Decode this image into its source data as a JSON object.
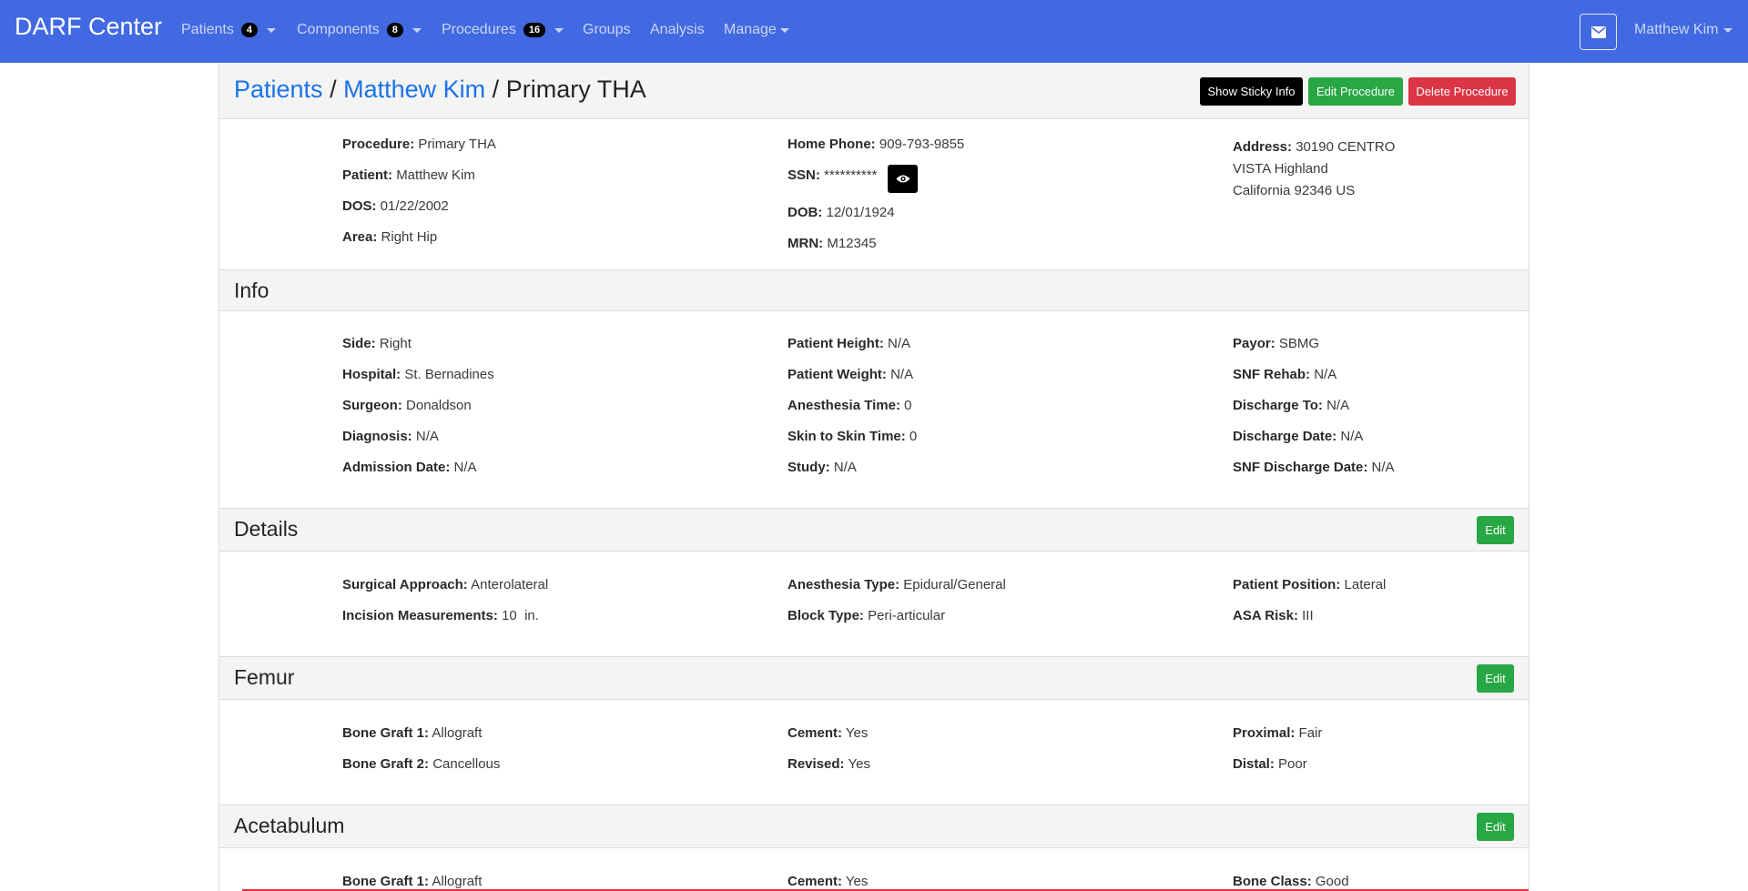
{
  "nav": {
    "brand": "DARF Center",
    "items": [
      {
        "label": "Patients",
        "badge": "4"
      },
      {
        "label": "Components",
        "badge": "8"
      },
      {
        "label": "Procedures",
        "badge": "16"
      },
      {
        "label": "Groups"
      },
      {
        "label": "Analysis"
      },
      {
        "label": "Manage"
      }
    ],
    "user": "Matthew Kim"
  },
  "breadcrumb": {
    "patients": "Patients",
    "patient": "Matthew Kim",
    "current": "Primary THA",
    "sep": "/"
  },
  "actions": {
    "sticky": "Show Sticky Info",
    "edit": "Edit Procedure",
    "delete": "Delete Procedure"
  },
  "summary": {
    "procedure": {
      "label": "Procedure:",
      "value": "Primary THA"
    },
    "patient": {
      "label": "Patient:",
      "value": "Matthew Kim"
    },
    "dos": {
      "label": "DOS:",
      "value": "01/22/2002"
    },
    "area": {
      "label": "Area:",
      "value": "Right Hip"
    },
    "home_phone": {
      "label": "Home Phone:",
      "value": "909-793-9855"
    },
    "ssn": {
      "label": "SSN:",
      "value": "**********"
    },
    "dob": {
      "label": "DOB:",
      "value": "12/01/1924"
    },
    "mrn": {
      "label": "MRN:",
      "value": "M12345"
    },
    "address": {
      "label": "Address:",
      "line1": "30190 CENTRO",
      "line2": "VISTA Highland",
      "line3": "California 92346 US"
    }
  },
  "info": {
    "title": "Info",
    "col1": [
      {
        "label": "Side:",
        "value": "Right"
      },
      {
        "label": "Hospital:",
        "value": "St. Bernadines"
      },
      {
        "label": "Surgeon:",
        "value": "Donaldson"
      },
      {
        "label": "Diagnosis:",
        "value": "N/A"
      },
      {
        "label": "Admission Date:",
        "value": "N/A"
      }
    ],
    "col2": [
      {
        "label": "Patient Height:",
        "value": "N/A"
      },
      {
        "label": "Patient Weight:",
        "value": "N/A"
      },
      {
        "label": "Anesthesia Time:",
        "value": "0"
      },
      {
        "label": "Skin to Skin Time:",
        "value": "0"
      },
      {
        "label": "Study:",
        "value": "N/A"
      }
    ],
    "col3": [
      {
        "label": "Payor:",
        "value": "SBMG"
      },
      {
        "label": "SNF Rehab:",
        "value": "N/A"
      },
      {
        "label": "Discharge To:",
        "value": "N/A"
      },
      {
        "label": "Discharge Date:",
        "value": "N/A"
      },
      {
        "label": "SNF Discharge Date:",
        "value": "N/A"
      }
    ]
  },
  "details": {
    "title": "Details",
    "edit": "Edit",
    "col1": [
      {
        "label": "Surgical Approach:",
        "value": "Anterolateral"
      },
      {
        "label": "Incision Measurements:",
        "value": "10  in."
      }
    ],
    "col2": [
      {
        "label": "Anesthesia Type:",
        "value": "Epidural/General"
      },
      {
        "label": "Block Type:",
        "value": "Peri-articular"
      }
    ],
    "col3": [
      {
        "label": "Patient Position:",
        "value": "Lateral"
      },
      {
        "label": "ASA Risk:",
        "value": "III"
      }
    ]
  },
  "femur": {
    "title": "Femur",
    "edit": "Edit",
    "col1": [
      {
        "label": "Bone Graft 1:",
        "value": "Allograft"
      },
      {
        "label": "Bone Graft 2:",
        "value": "Cancellous"
      }
    ],
    "col2": [
      {
        "label": "Cement:",
        "value": "Yes"
      },
      {
        "label": "Revised:",
        "value": "Yes"
      }
    ],
    "col3": [
      {
        "label": "Proximal:",
        "value": "Fair"
      },
      {
        "label": "Distal:",
        "value": "Poor"
      }
    ]
  },
  "acetabulum": {
    "title": "Acetabulum",
    "edit": "Edit",
    "col1": [
      {
        "label": "Bone Graft 1:",
        "value": "Allograft"
      }
    ],
    "col2": [
      {
        "label": "Cement:",
        "value": "Yes"
      }
    ],
    "col3": [
      {
        "label": "Bone Class:",
        "value": "Good"
      }
    ]
  },
  "colors": {
    "navbar": "#4169e1",
    "link": "#1a73e8",
    "green": "#28a745",
    "red": "#dc3545"
  }
}
